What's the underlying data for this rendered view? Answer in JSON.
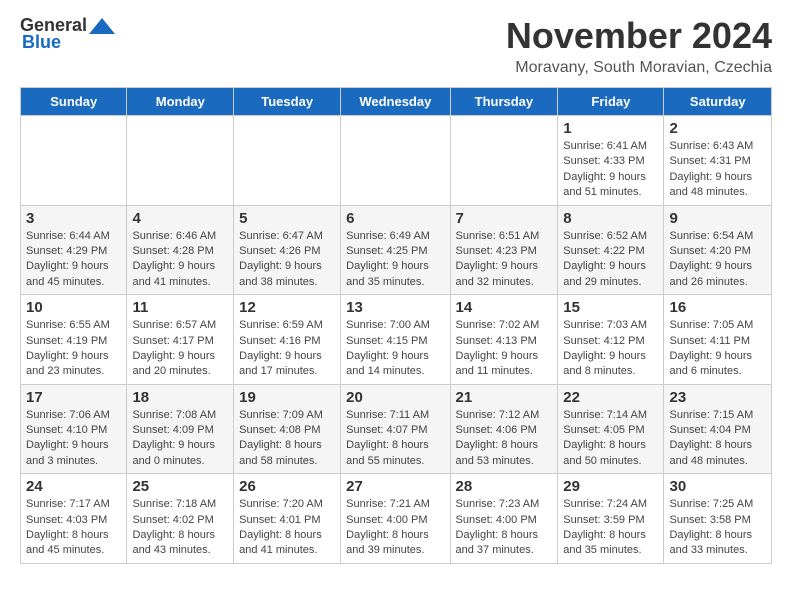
{
  "header": {
    "logo_general": "General",
    "logo_blue": "Blue",
    "month_title": "November 2024",
    "location": "Moravany, South Moravian, Czechia"
  },
  "days_of_week": [
    "Sunday",
    "Monday",
    "Tuesday",
    "Wednesday",
    "Thursday",
    "Friday",
    "Saturday"
  ],
  "weeks": [
    [
      {
        "num": "",
        "info": ""
      },
      {
        "num": "",
        "info": ""
      },
      {
        "num": "",
        "info": ""
      },
      {
        "num": "",
        "info": ""
      },
      {
        "num": "",
        "info": ""
      },
      {
        "num": "1",
        "info": "Sunrise: 6:41 AM\nSunset: 4:33 PM\nDaylight: 9 hours and 51 minutes."
      },
      {
        "num": "2",
        "info": "Sunrise: 6:43 AM\nSunset: 4:31 PM\nDaylight: 9 hours and 48 minutes."
      }
    ],
    [
      {
        "num": "3",
        "info": "Sunrise: 6:44 AM\nSunset: 4:29 PM\nDaylight: 9 hours and 45 minutes."
      },
      {
        "num": "4",
        "info": "Sunrise: 6:46 AM\nSunset: 4:28 PM\nDaylight: 9 hours and 41 minutes."
      },
      {
        "num": "5",
        "info": "Sunrise: 6:47 AM\nSunset: 4:26 PM\nDaylight: 9 hours and 38 minutes."
      },
      {
        "num": "6",
        "info": "Sunrise: 6:49 AM\nSunset: 4:25 PM\nDaylight: 9 hours and 35 minutes."
      },
      {
        "num": "7",
        "info": "Sunrise: 6:51 AM\nSunset: 4:23 PM\nDaylight: 9 hours and 32 minutes."
      },
      {
        "num": "8",
        "info": "Sunrise: 6:52 AM\nSunset: 4:22 PM\nDaylight: 9 hours and 29 minutes."
      },
      {
        "num": "9",
        "info": "Sunrise: 6:54 AM\nSunset: 4:20 PM\nDaylight: 9 hours and 26 minutes."
      }
    ],
    [
      {
        "num": "10",
        "info": "Sunrise: 6:55 AM\nSunset: 4:19 PM\nDaylight: 9 hours and 23 minutes."
      },
      {
        "num": "11",
        "info": "Sunrise: 6:57 AM\nSunset: 4:17 PM\nDaylight: 9 hours and 20 minutes."
      },
      {
        "num": "12",
        "info": "Sunrise: 6:59 AM\nSunset: 4:16 PM\nDaylight: 9 hours and 17 minutes."
      },
      {
        "num": "13",
        "info": "Sunrise: 7:00 AM\nSunset: 4:15 PM\nDaylight: 9 hours and 14 minutes."
      },
      {
        "num": "14",
        "info": "Sunrise: 7:02 AM\nSunset: 4:13 PM\nDaylight: 9 hours and 11 minutes."
      },
      {
        "num": "15",
        "info": "Sunrise: 7:03 AM\nSunset: 4:12 PM\nDaylight: 9 hours and 8 minutes."
      },
      {
        "num": "16",
        "info": "Sunrise: 7:05 AM\nSunset: 4:11 PM\nDaylight: 9 hours and 6 minutes."
      }
    ],
    [
      {
        "num": "17",
        "info": "Sunrise: 7:06 AM\nSunset: 4:10 PM\nDaylight: 9 hours and 3 minutes."
      },
      {
        "num": "18",
        "info": "Sunrise: 7:08 AM\nSunset: 4:09 PM\nDaylight: 9 hours and 0 minutes."
      },
      {
        "num": "19",
        "info": "Sunrise: 7:09 AM\nSunset: 4:08 PM\nDaylight: 8 hours and 58 minutes."
      },
      {
        "num": "20",
        "info": "Sunrise: 7:11 AM\nSunset: 4:07 PM\nDaylight: 8 hours and 55 minutes."
      },
      {
        "num": "21",
        "info": "Sunrise: 7:12 AM\nSunset: 4:06 PM\nDaylight: 8 hours and 53 minutes."
      },
      {
        "num": "22",
        "info": "Sunrise: 7:14 AM\nSunset: 4:05 PM\nDaylight: 8 hours and 50 minutes."
      },
      {
        "num": "23",
        "info": "Sunrise: 7:15 AM\nSunset: 4:04 PM\nDaylight: 8 hours and 48 minutes."
      }
    ],
    [
      {
        "num": "24",
        "info": "Sunrise: 7:17 AM\nSunset: 4:03 PM\nDaylight: 8 hours and 45 minutes."
      },
      {
        "num": "25",
        "info": "Sunrise: 7:18 AM\nSunset: 4:02 PM\nDaylight: 8 hours and 43 minutes."
      },
      {
        "num": "26",
        "info": "Sunrise: 7:20 AM\nSunset: 4:01 PM\nDaylight: 8 hours and 41 minutes."
      },
      {
        "num": "27",
        "info": "Sunrise: 7:21 AM\nSunset: 4:00 PM\nDaylight: 8 hours and 39 minutes."
      },
      {
        "num": "28",
        "info": "Sunrise: 7:23 AM\nSunset: 4:00 PM\nDaylight: 8 hours and 37 minutes."
      },
      {
        "num": "29",
        "info": "Sunrise: 7:24 AM\nSunset: 3:59 PM\nDaylight: 8 hours and 35 minutes."
      },
      {
        "num": "30",
        "info": "Sunrise: 7:25 AM\nSunset: 3:58 PM\nDaylight: 8 hours and 33 minutes."
      }
    ]
  ]
}
